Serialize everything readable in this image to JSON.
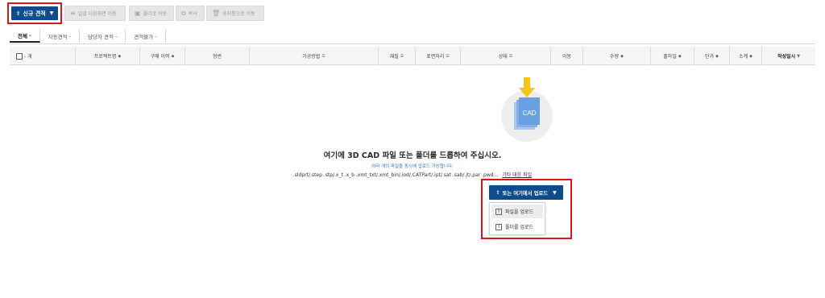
{
  "toolbar": {
    "new_quote_label": "신규 견적",
    "bulk_order_label": "일괄 다음화면 이동",
    "folder_move_label": "폴더로 이동",
    "copy_label": "복사",
    "trash_label": "휴지통으로 이동"
  },
  "tabs": [
    {
      "label": "전체",
      "active": true
    },
    {
      "label": "자동견적",
      "active": false
    },
    {
      "label": "담당자 견적",
      "active": false
    },
    {
      "label": "견적불가",
      "active": false
    }
  ],
  "table": {
    "select_label": "- 개",
    "columns": [
      "프로젝트명",
      "구매 이력",
      "형번",
      "가공방법",
      "재질",
      "표면처리",
      "상태",
      "이동",
      "수량",
      "출하일",
      "단가",
      "소계",
      "작성일시"
    ]
  },
  "upload": {
    "cad_label": "CAD",
    "title": "여기에 3D CAD 파일 또는 폴더를 드롭하여 주십시오.",
    "subtitle": "여러 개의 파일을 동시에 업로드 가능합니다.",
    "extensions": ".sldprt/.step .stp/.x_t .x_b .xmt_txt/.xmt_bin/.iod/.CATPart/.ipt/.sat .sab/.jt/.par .pwd...",
    "other_formats_link": "기타 대응 파일",
    "button_label": "또는 여기에서 업로드",
    "menu": [
      {
        "label": "파일을 업로드",
        "icon": "file-upload-icon"
      },
      {
        "label": "폴더를 업로드",
        "icon": "folder-upload-icon"
      }
    ]
  },
  "colors": {
    "primary": "#0f4c8c",
    "highlight": "#d9161c",
    "arrow": "#f5c518",
    "doc": "#6aa0df"
  }
}
